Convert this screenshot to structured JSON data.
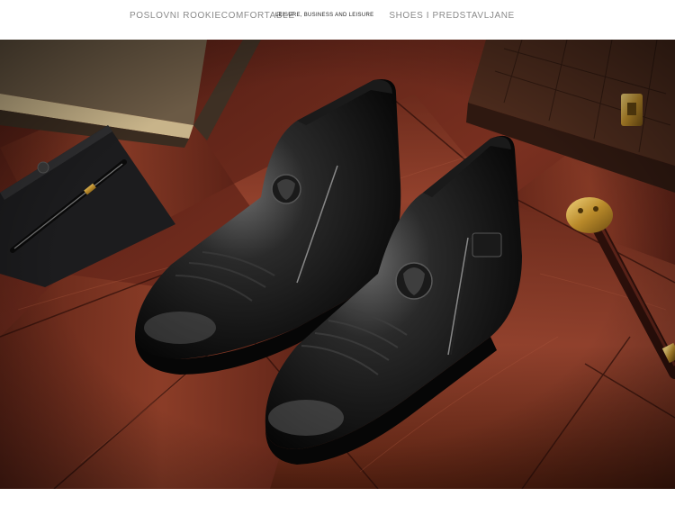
{
  "header": {
    "title": "POSLOVNI ROOKIECOMFORTABLE",
    "title_tail": "SHOES I PREDSTAVLJANE",
    "overlay_text": "LEISURE, BUSINESS AND LEISURE"
  },
  "photo": {
    "subject": "black-leather-zip-ankle-boots",
    "colors": {
      "floor_dark": "#3a1510",
      "floor_mid": "#6a2a1e",
      "floor_light": "#8e3d2a",
      "leather": "#0d0d0d",
      "leather_highlight": "#5a5a5a",
      "brass": "#c79b3a"
    }
  }
}
